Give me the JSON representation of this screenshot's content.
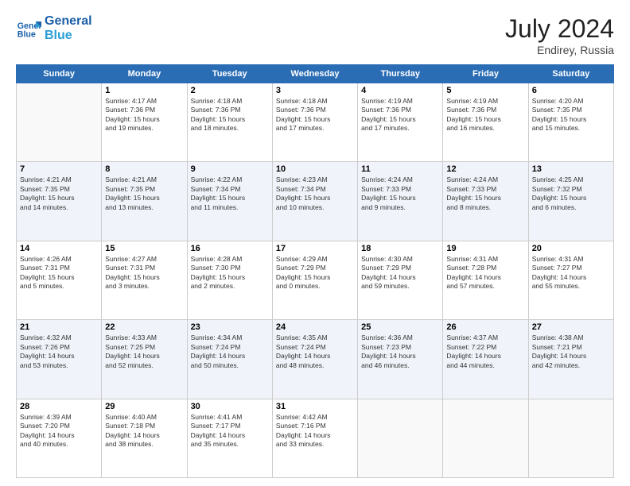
{
  "header": {
    "logo_line1": "General",
    "logo_line2": "Blue",
    "month_year": "July 2024",
    "location": "Endirey, Russia"
  },
  "weekdays": [
    "Sunday",
    "Monday",
    "Tuesday",
    "Wednesday",
    "Thursday",
    "Friday",
    "Saturday"
  ],
  "weeks": [
    [
      {
        "day": "",
        "info": ""
      },
      {
        "day": "1",
        "info": "Sunrise: 4:17 AM\nSunset: 7:36 PM\nDaylight: 15 hours\nand 19 minutes."
      },
      {
        "day": "2",
        "info": "Sunrise: 4:18 AM\nSunset: 7:36 PM\nDaylight: 15 hours\nand 18 minutes."
      },
      {
        "day": "3",
        "info": "Sunrise: 4:18 AM\nSunset: 7:36 PM\nDaylight: 15 hours\nand 17 minutes."
      },
      {
        "day": "4",
        "info": "Sunrise: 4:19 AM\nSunset: 7:36 PM\nDaylight: 15 hours\nand 17 minutes."
      },
      {
        "day": "5",
        "info": "Sunrise: 4:19 AM\nSunset: 7:36 PM\nDaylight: 15 hours\nand 16 minutes."
      },
      {
        "day": "6",
        "info": "Sunrise: 4:20 AM\nSunset: 7:35 PM\nDaylight: 15 hours\nand 15 minutes."
      }
    ],
    [
      {
        "day": "7",
        "info": "Sunrise: 4:21 AM\nSunset: 7:35 PM\nDaylight: 15 hours\nand 14 minutes."
      },
      {
        "day": "8",
        "info": "Sunrise: 4:21 AM\nSunset: 7:35 PM\nDaylight: 15 hours\nand 13 minutes."
      },
      {
        "day": "9",
        "info": "Sunrise: 4:22 AM\nSunset: 7:34 PM\nDaylight: 15 hours\nand 11 minutes."
      },
      {
        "day": "10",
        "info": "Sunrise: 4:23 AM\nSunset: 7:34 PM\nDaylight: 15 hours\nand 10 minutes."
      },
      {
        "day": "11",
        "info": "Sunrise: 4:24 AM\nSunset: 7:33 PM\nDaylight: 15 hours\nand 9 minutes."
      },
      {
        "day": "12",
        "info": "Sunrise: 4:24 AM\nSunset: 7:33 PM\nDaylight: 15 hours\nand 8 minutes."
      },
      {
        "day": "13",
        "info": "Sunrise: 4:25 AM\nSunset: 7:32 PM\nDaylight: 15 hours\nand 6 minutes."
      }
    ],
    [
      {
        "day": "14",
        "info": "Sunrise: 4:26 AM\nSunset: 7:31 PM\nDaylight: 15 hours\nand 5 minutes."
      },
      {
        "day": "15",
        "info": "Sunrise: 4:27 AM\nSunset: 7:31 PM\nDaylight: 15 hours\nand 3 minutes."
      },
      {
        "day": "16",
        "info": "Sunrise: 4:28 AM\nSunset: 7:30 PM\nDaylight: 15 hours\nand 2 minutes."
      },
      {
        "day": "17",
        "info": "Sunrise: 4:29 AM\nSunset: 7:29 PM\nDaylight: 15 hours\nand 0 minutes."
      },
      {
        "day": "18",
        "info": "Sunrise: 4:30 AM\nSunset: 7:29 PM\nDaylight: 14 hours\nand 59 minutes."
      },
      {
        "day": "19",
        "info": "Sunrise: 4:31 AM\nSunset: 7:28 PM\nDaylight: 14 hours\nand 57 minutes."
      },
      {
        "day": "20",
        "info": "Sunrise: 4:31 AM\nSunset: 7:27 PM\nDaylight: 14 hours\nand 55 minutes."
      }
    ],
    [
      {
        "day": "21",
        "info": "Sunrise: 4:32 AM\nSunset: 7:26 PM\nDaylight: 14 hours\nand 53 minutes."
      },
      {
        "day": "22",
        "info": "Sunrise: 4:33 AM\nSunset: 7:25 PM\nDaylight: 14 hours\nand 52 minutes."
      },
      {
        "day": "23",
        "info": "Sunrise: 4:34 AM\nSunset: 7:24 PM\nDaylight: 14 hours\nand 50 minutes."
      },
      {
        "day": "24",
        "info": "Sunrise: 4:35 AM\nSunset: 7:24 PM\nDaylight: 14 hours\nand 48 minutes."
      },
      {
        "day": "25",
        "info": "Sunrise: 4:36 AM\nSunset: 7:23 PM\nDaylight: 14 hours\nand 46 minutes."
      },
      {
        "day": "26",
        "info": "Sunrise: 4:37 AM\nSunset: 7:22 PM\nDaylight: 14 hours\nand 44 minutes."
      },
      {
        "day": "27",
        "info": "Sunrise: 4:38 AM\nSunset: 7:21 PM\nDaylight: 14 hours\nand 42 minutes."
      }
    ],
    [
      {
        "day": "28",
        "info": "Sunrise: 4:39 AM\nSunset: 7:20 PM\nDaylight: 14 hours\nand 40 minutes."
      },
      {
        "day": "29",
        "info": "Sunrise: 4:40 AM\nSunset: 7:18 PM\nDaylight: 14 hours\nand 38 minutes."
      },
      {
        "day": "30",
        "info": "Sunrise: 4:41 AM\nSunset: 7:17 PM\nDaylight: 14 hours\nand 35 minutes."
      },
      {
        "day": "31",
        "info": "Sunrise: 4:42 AM\nSunset: 7:16 PM\nDaylight: 14 hours\nand 33 minutes."
      },
      {
        "day": "",
        "info": ""
      },
      {
        "day": "",
        "info": ""
      },
      {
        "day": "",
        "info": ""
      }
    ]
  ]
}
